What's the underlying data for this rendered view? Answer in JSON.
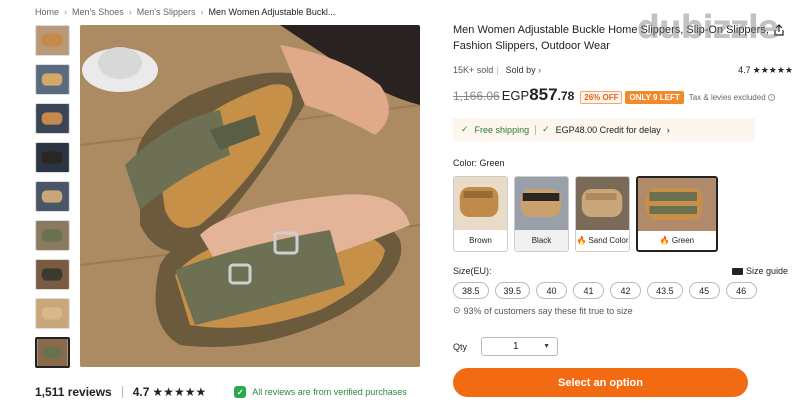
{
  "breadcrumb": [
    "Home",
    "Men's Shoes",
    "Men's Slippers",
    "Men Women Adjustable Buckl..."
  ],
  "product": {
    "title": "Men Women Adjustable Buckle Home Slippers, Slip-On Slippers, Fashion Slippers, Outdoor Wear",
    "sold": "15K+ sold",
    "sold_by": "Sold by",
    "rating": "4.7",
    "stars": "★★★★★"
  },
  "price": {
    "old": "1,166.06",
    "currency": "EGP",
    "main": "857",
    "decimal": ".78",
    "discount": "26% OFF",
    "stock": "ONLY 9 LEFT",
    "tax": "Tax & levies excluded"
  },
  "shipping": {
    "free": "Free shipping",
    "credit": "EGP48.00 Credit for delay"
  },
  "color": {
    "label": "Color: Green",
    "options": [
      {
        "label": "Brown",
        "color": "#c08a4a"
      },
      {
        "label": "Black",
        "color": "#2a2622"
      },
      {
        "label": "Sand Color",
        "color": "#c9a77a"
      },
      {
        "label": "Green",
        "color": "#6b7050"
      }
    ]
  },
  "size": {
    "label": "Size(EU):",
    "guide": "Size guide",
    "options": [
      "38.5",
      "39.5",
      "40",
      "41",
      "42",
      "43.5",
      "45",
      "46"
    ],
    "fit_note": "93% of customers say these fit true to size"
  },
  "qty": {
    "label": "Qty",
    "value": "1"
  },
  "cta": "Select an option",
  "reviews": {
    "count": "1,511 reviews",
    "rating": "4.7",
    "stars": "★★★★★",
    "verified": "All reviews are from verified purchases"
  },
  "watermark": "dubizzle"
}
